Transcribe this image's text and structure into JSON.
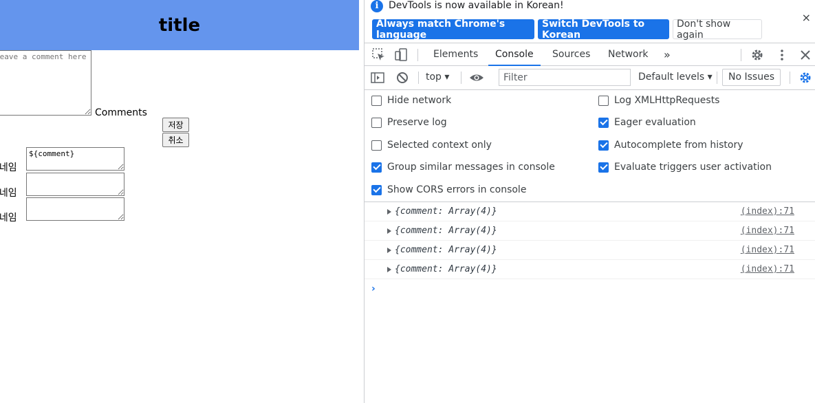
{
  "page": {
    "title": "title",
    "comment_placeholder": "leave a comment here",
    "comments_label": "Comments",
    "save_label": "저장",
    "cancel_label": "취소",
    "rows": [
      {
        "label": "닉네임",
        "value": "${comment}"
      },
      {
        "label": "닉네임",
        "value": ""
      },
      {
        "label": "닉네임",
        "value": ""
      }
    ]
  },
  "devtools": {
    "infobar": {
      "message": "DevTools is now available in Korean!",
      "match_label": "Always match Chrome's language",
      "switch_label": "Switch DevTools to Korean",
      "dont_show_label": "Don't show again",
      "close_glyph": "×"
    },
    "tabs": [
      {
        "label": "Elements",
        "active": false
      },
      {
        "label": "Console",
        "active": true
      },
      {
        "label": "Sources",
        "active": false
      },
      {
        "label": "Network",
        "active": false
      }
    ],
    "more_tabs_glyph": "»",
    "toolbar": {
      "context": "top",
      "filter_placeholder": "Filter",
      "levels_label": "Default levels",
      "issues_label": "No Issues"
    },
    "settings": {
      "left": [
        {
          "label": "Hide network",
          "checked": false
        },
        {
          "label": "Preserve log",
          "checked": false
        },
        {
          "label": "Selected context only",
          "checked": false
        },
        {
          "label": "Group similar messages in console",
          "checked": true
        },
        {
          "label": "Show CORS errors in console",
          "checked": true
        }
      ],
      "right": [
        {
          "label": "Log XMLHttpRequests",
          "checked": false
        },
        {
          "label": "Eager evaluation",
          "checked": true
        },
        {
          "label": "Autocomplete from history",
          "checked": true
        },
        {
          "label": "Evaluate triggers user activation",
          "checked": true
        }
      ]
    },
    "logs": [
      {
        "text": "{comment: Array(4)}",
        "source": "(index):71"
      },
      {
        "text": "{comment: Array(4)}",
        "source": "(index):71"
      },
      {
        "text": "{comment: Array(4)}",
        "source": "(index):71"
      },
      {
        "text": "{comment: Array(4)}",
        "source": "(index):71"
      }
    ],
    "prompt_glyph": "›",
    "accent_color": "#1a73e8"
  }
}
